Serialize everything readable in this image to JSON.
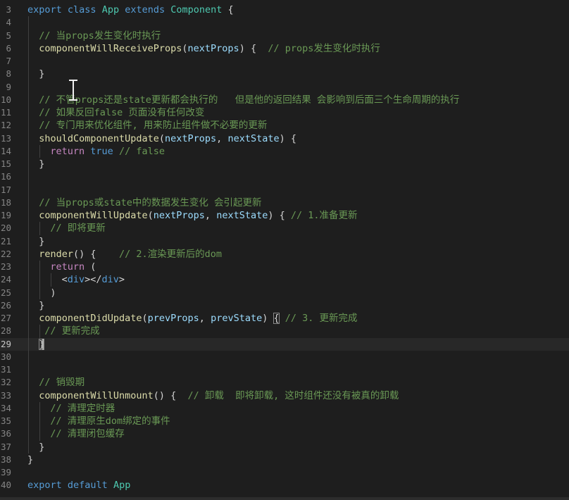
{
  "editor": {
    "colors": {
      "background": "#1e1e1e",
      "keyword": "#569cd6",
      "class": "#4ec9b0",
      "function": "#dcdcaa",
      "parameter": "#9cdcfe",
      "comment": "#6a9955",
      "text": "#d4d4d4",
      "line_number": "#858585"
    },
    "active_line": 29,
    "lines": [
      {
        "n": "3",
        "segs": [
          [
            "kw",
            "export "
          ],
          [
            "kw",
            "class "
          ],
          [
            "cls",
            "App "
          ],
          [
            "kw",
            "extends "
          ],
          [
            "cls",
            "Component "
          ],
          [
            "pun",
            "{"
          ]
        ]
      },
      {
        "n": "4",
        "segs": []
      },
      {
        "n": "5",
        "segs": [
          [
            "cmt",
            "// 当props发生变化时执行"
          ]
        ]
      },
      {
        "n": "6",
        "segs": [
          [
            "func",
            "componentWillReceiveProps"
          ],
          [
            "pun",
            "("
          ],
          [
            "param",
            "nextProps"
          ],
          [
            "pun",
            ") {  "
          ],
          [
            "cmt",
            "// props发生变化时执行"
          ]
        ]
      },
      {
        "n": "7",
        "segs": []
      },
      {
        "n": "8",
        "segs": [
          [
            "pun",
            "}"
          ]
        ]
      },
      {
        "n": "9",
        "segs": []
      },
      {
        "n": "10",
        "segs": [
          [
            "cmt",
            "// 不管props还是state更新都会执行的   但是他的返回结果 会影响到后面三个生命周期的执行"
          ]
        ]
      },
      {
        "n": "11",
        "segs": [
          [
            "cmt",
            "// 如果反回false 页面没有任何改变"
          ]
        ]
      },
      {
        "n": "12",
        "segs": [
          [
            "cmt",
            "// 专门用来优化组件, 用来防止组件做不必要的更新"
          ]
        ]
      },
      {
        "n": "13",
        "segs": [
          [
            "func",
            "shouldComponentUpdate"
          ],
          [
            "pun",
            "("
          ],
          [
            "param",
            "nextProps"
          ],
          [
            "pun",
            ", "
          ],
          [
            "param",
            "nextState"
          ],
          [
            "pun",
            ") {"
          ]
        ]
      },
      {
        "n": "14",
        "segs": [
          [
            "ctrl",
            "return "
          ],
          [
            "kw",
            "true "
          ],
          [
            "cmt",
            "// false"
          ]
        ]
      },
      {
        "n": "15",
        "segs": [
          [
            "pun",
            "}"
          ]
        ]
      },
      {
        "n": "16",
        "segs": []
      },
      {
        "n": "17",
        "segs": []
      },
      {
        "n": "18",
        "segs": [
          [
            "cmt",
            "// 当props或state中的数据发生变化 会引起更新"
          ]
        ]
      },
      {
        "n": "19",
        "segs": [
          [
            "func",
            "componentWillUpdate"
          ],
          [
            "pun",
            "("
          ],
          [
            "param",
            "nextProps"
          ],
          [
            "pun",
            ", "
          ],
          [
            "param",
            "nextState"
          ],
          [
            "pun",
            ") { "
          ],
          [
            "cmt",
            "// 1.准备更新"
          ]
        ]
      },
      {
        "n": "20",
        "segs": [
          [
            "cmt",
            "// 即将更新"
          ]
        ]
      },
      {
        "n": "21",
        "segs": [
          [
            "pun",
            "}"
          ]
        ]
      },
      {
        "n": "22",
        "segs": [
          [
            "func",
            "render"
          ],
          [
            "pun",
            "() {    "
          ],
          [
            "cmt",
            "// 2.渲染更新后的dom"
          ]
        ]
      },
      {
        "n": "23",
        "segs": [
          [
            "ctrl",
            "return "
          ],
          [
            "pun",
            "("
          ]
        ]
      },
      {
        "n": "24",
        "segs": [
          [
            "pun",
            "<"
          ],
          [
            "tag",
            "div"
          ],
          [
            "pun",
            "></"
          ],
          [
            "tag",
            "div"
          ],
          [
            "pun",
            ">"
          ]
        ]
      },
      {
        "n": "25",
        "segs": [
          [
            "pun",
            ")"
          ]
        ]
      },
      {
        "n": "26",
        "segs": [
          [
            "pun",
            "}"
          ]
        ]
      },
      {
        "n": "27",
        "segs": [
          [
            "func",
            "componentDidUpdate"
          ],
          [
            "pun",
            "("
          ],
          [
            "param",
            "prevProps"
          ],
          [
            "pun",
            ", "
          ],
          [
            "param",
            "prevState"
          ],
          [
            "pun",
            ") "
          ],
          [
            "box",
            "{"
          ],
          [
            "pun",
            " "
          ],
          [
            "cmt",
            "// 3. 更新完成"
          ]
        ]
      },
      {
        "n": "28",
        "segs": [
          [
            "cmt",
            "// 更新完成"
          ]
        ]
      },
      {
        "n": "29",
        "segs": [
          [
            "box",
            "}"
          ]
        ]
      },
      {
        "n": "30",
        "segs": []
      },
      {
        "n": "31",
        "segs": []
      },
      {
        "n": "32",
        "segs": [
          [
            "cmt",
            "// 销毁期"
          ]
        ]
      },
      {
        "n": "33",
        "segs": [
          [
            "func",
            "componentWillUnmount"
          ],
          [
            "pun",
            "() {  "
          ],
          [
            "cmt",
            "// 卸载  即将卸载, 这时组件还没有被真的卸载"
          ]
        ]
      },
      {
        "n": "34",
        "segs": [
          [
            "cmt",
            "// 清理定时器"
          ]
        ]
      },
      {
        "n": "35",
        "segs": [
          [
            "cmt",
            "// 清理原生dom绑定的事件"
          ]
        ]
      },
      {
        "n": "36",
        "segs": [
          [
            "cmt",
            "// 清理闭包缓存"
          ]
        ]
      },
      {
        "n": "37",
        "segs": [
          [
            "pun",
            "}"
          ]
        ]
      },
      {
        "n": "38",
        "segs": [
          [
            "pun",
            "}"
          ]
        ]
      },
      {
        "n": "39",
        "segs": []
      },
      {
        "n": "40",
        "segs": [
          [
            "kw",
            "export "
          ],
          [
            "kw",
            "default "
          ],
          [
            "cls",
            "App"
          ]
        ]
      }
    ]
  }
}
